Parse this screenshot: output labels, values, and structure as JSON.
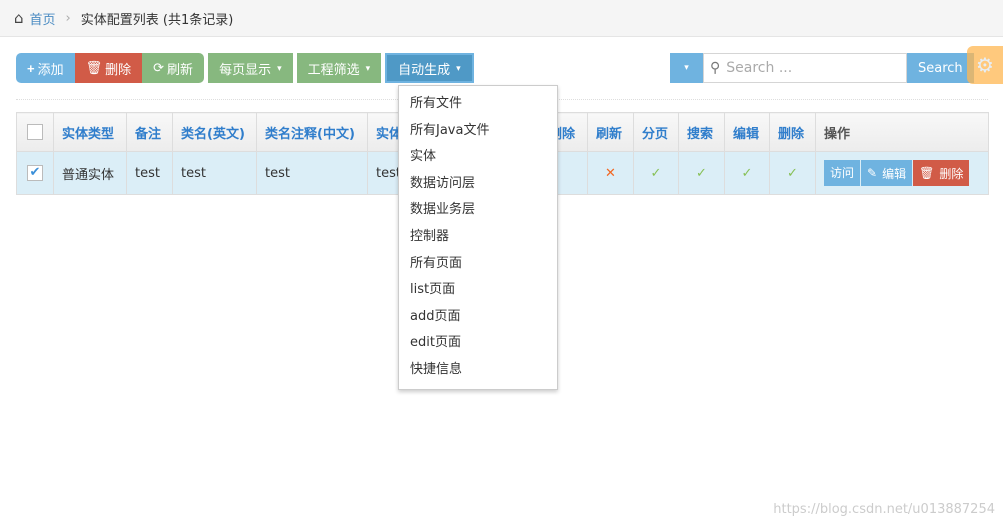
{
  "breadcrumb": {
    "home": "首页",
    "current": "实体配置列表 (共1条记录)"
  },
  "toolbar": {
    "add": "添加",
    "delete": "删除",
    "refresh": "刷新",
    "page_size": "每页显示",
    "project_filter": "工程筛选",
    "auto_generate": "自动生成"
  },
  "search": {
    "placeholder": "Search ...",
    "button": "Search"
  },
  "table": {
    "headers": [
      "实体类型",
      "备注",
      "类名(英文)",
      "类名注释(中文)",
      "实体",
      "删除",
      "刷新",
      "分页",
      "搜索",
      "编辑",
      "删除",
      "操作"
    ],
    "rows": [
      {
        "checked": true,
        "type": "普通实体",
        "remark": "test",
        "class_en": "test",
        "class_cn": "test",
        "entity": "test",
        "refresh": "✕",
        "paging": "✓",
        "search": "✓",
        "edit": "✓",
        "delete": "✓"
      }
    ],
    "actions": {
      "visit": "访问",
      "edit": "编辑",
      "delete": "删除"
    }
  },
  "menu": [
    "所有文件",
    "所有Java文件",
    "实体",
    "数据访问层",
    "数据业务层",
    "控制器",
    "所有页面",
    "list页面",
    "add页面",
    "edit页面",
    "快捷信息"
  ],
  "watermark": "https://blog.csdn.net/u013887254"
}
